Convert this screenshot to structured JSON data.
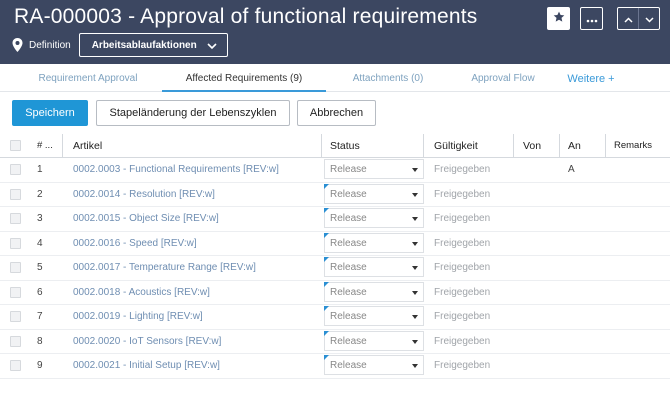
{
  "header": {
    "title": "RA-000003 - Approval of functional requirements",
    "definition_label": "Definition",
    "workflow_button": "Arbeitsablaufaktionen"
  },
  "icons": {
    "definition": "map-pin-icon",
    "workflow_caret": "chevron-down-icon",
    "favorite": "star-icon",
    "more": "ellipsis-icon",
    "prev": "chevron-up-icon",
    "next": "chevron-down-icon",
    "status_caret": "caret-down-icon"
  },
  "tabs": [
    {
      "label": "Requirement Approval",
      "active": false
    },
    {
      "label": "Affected Requirements (9)",
      "active": true
    },
    {
      "label": "Attachments (0)",
      "active": false
    },
    {
      "label": "Approval Flow",
      "active": false
    },
    {
      "label": "Weitere +",
      "active": false
    }
  ],
  "actions": {
    "save": "Speichern",
    "bulk": "Stapeländerung der Lebenszyklen",
    "cancel": "Abbrechen"
  },
  "table": {
    "columns": [
      "# ...",
      "Artikel",
      "Status",
      "Gültigkeit",
      "Von",
      "An",
      "Remarks"
    ],
    "rows": [
      {
        "num": "1",
        "article": "0002.0003 - Functional Requirements [REV:w]",
        "status": "Release",
        "validity": "Freigegeben",
        "from": "",
        "to": "A"
      },
      {
        "num": "2",
        "article": "0002.0014 - Resolution [REV:w]",
        "status": "Release",
        "validity": "Freigegeben",
        "from": "",
        "to": ""
      },
      {
        "num": "3",
        "article": "0002.0015 - Object Size [REV:w]",
        "status": "Release",
        "validity": "Freigegeben",
        "from": "",
        "to": ""
      },
      {
        "num": "4",
        "article": "0002.0016 - Speed [REV:w]",
        "status": "Release",
        "validity": "Freigegeben",
        "from": "",
        "to": ""
      },
      {
        "num": "5",
        "article": "0002.0017 - Temperature Range [REV:w]",
        "status": "Release",
        "validity": "Freigegeben",
        "from": "",
        "to": ""
      },
      {
        "num": "6",
        "article": "0002.0018 - Acoustics [REV:w]",
        "status": "Release",
        "validity": "Freigegeben",
        "from": "",
        "to": ""
      },
      {
        "num": "7",
        "article": "0002.0019 - Lighting [REV:w]",
        "status": "Release",
        "validity": "Freigegeben",
        "from": "",
        "to": ""
      },
      {
        "num": "8",
        "article": "0002.0020 - IoT Sensors [REV:w]",
        "status": "Release",
        "validity": "Freigegeben",
        "from": "",
        "to": ""
      },
      {
        "num": "9",
        "article": "0002.0021 - Initial Setup [REV:w]",
        "status": "Release",
        "validity": "Freigegeben",
        "from": "",
        "to": ""
      }
    ]
  },
  "colors": {
    "header_bg": "#3c4761",
    "accent": "#1f96d6",
    "link": "#6f8eb2",
    "status_flag": "#2a8fd3"
  }
}
